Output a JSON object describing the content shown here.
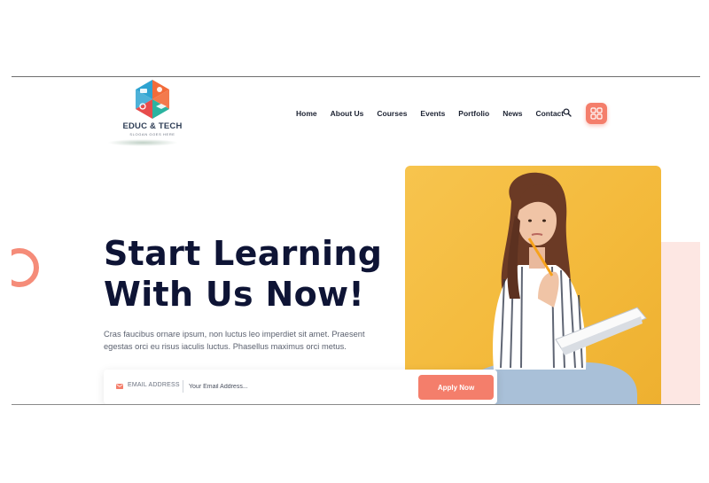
{
  "brand": {
    "name": "EDUC & TECH",
    "slogan": "SLOGAN GOES HERE",
    "colors": {
      "blue": "#2ea3d1",
      "orange": "#f26b3a",
      "red": "#e74c4c",
      "green": "#2bb3a0"
    }
  },
  "nav": {
    "items": [
      {
        "label": "Home"
      },
      {
        "label": "About Us"
      },
      {
        "label": "Courses"
      },
      {
        "label": "Events"
      },
      {
        "label": "Portfolio"
      },
      {
        "label": "News"
      },
      {
        "label": "Contact"
      }
    ],
    "search_icon": "search-icon",
    "menu_icon": "grid-icon"
  },
  "hero": {
    "title_line1": "Start Learning",
    "title_line2": "With Us Now!",
    "description": "Cras faucibus ornare ipsum, non luctus leo imperdiet sit amet. Praesent egestas orci eu risus iaculis luctus. Phasellus maximus orci metus."
  },
  "subscribe": {
    "label": "EMAIL ADDRESS",
    "placeholder": "Your Email Address...",
    "button_label": "Apply Now"
  },
  "theme": {
    "accent": "#f47e6b",
    "title_color": "#0e1435",
    "image_bg": "#f5bd42",
    "pink_panel": "#fde7e3"
  }
}
